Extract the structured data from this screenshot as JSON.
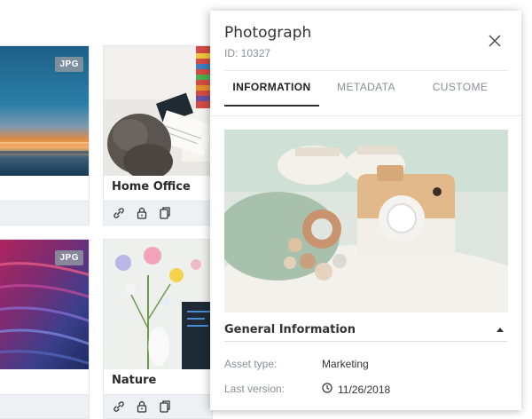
{
  "cards": [
    {
      "badge": "JPG",
      "name": ""
    },
    {
      "badge": "",
      "name": "Home Office"
    },
    {
      "badge": "JPG",
      "name": ""
    },
    {
      "badge": "",
      "name": "Nature"
    }
  ],
  "card_action_icons": [
    "link-icon",
    "lock-icon",
    "copy-icon"
  ],
  "panel": {
    "title": "Photograph",
    "id_text": "ID: 10327",
    "tabs": [
      {
        "label": "INFORMATION",
        "active": true
      },
      {
        "label": "METADATA",
        "active": false
      },
      {
        "label": "CUSTOME",
        "active": false
      }
    ],
    "section_title": "General Information",
    "fields": [
      {
        "key": "Asset type:",
        "value": "Marketing"
      },
      {
        "key": "Last version:",
        "value": "11/26/2018",
        "icon": "clock-icon"
      }
    ]
  },
  "colors": {
    "accent": "#333333",
    "muted": "#8a8f96",
    "bar": "#eef1f4"
  }
}
